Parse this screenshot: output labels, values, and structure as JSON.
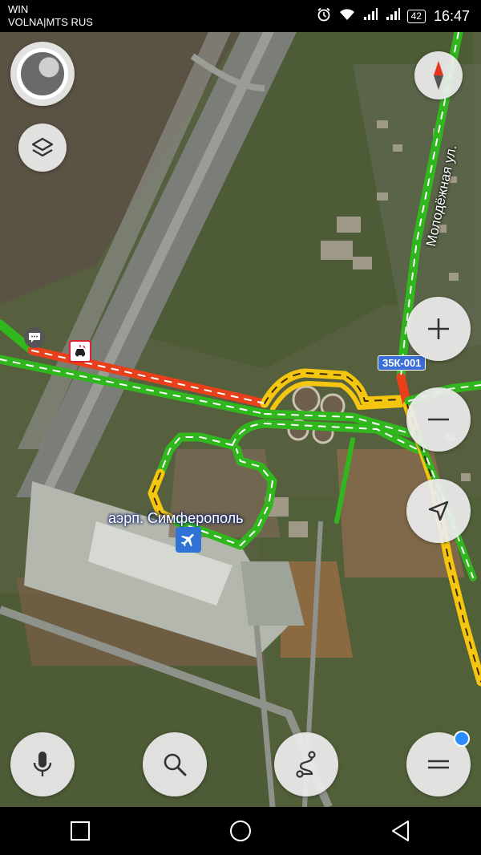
{
  "status_bar": {
    "carrier_line1": "WIN",
    "carrier_line2": "VOLNA|MTS RUS",
    "battery": "42",
    "time": "16:47",
    "icons": [
      "alarm-icon",
      "wifi-icon",
      "signal-icon",
      "signal-icon",
      "battery-icon"
    ]
  },
  "map": {
    "road_label": "Молодёжная ул.",
    "route_badge": "35К-001",
    "poi_label": "аэрп. Симферополь",
    "poi_icon": "airplane-icon",
    "incident_icon": "road-accident-icon",
    "chat_icon": "chat-bubble-icon"
  },
  "controls": {
    "profile": "profile-avatar",
    "layers": "layers-icon",
    "compass": "compass-icon",
    "zoom_in": "plus-icon",
    "zoom_out": "minus-icon",
    "my_location": "location-arrow-icon",
    "voice": "microphone-icon",
    "search": "search-icon",
    "routes": "route-icon",
    "menu": "menu-icon"
  },
  "traffic_colors": {
    "free": "#31b71e",
    "slow": "#f5c60f",
    "jam": "#e8401a"
  },
  "nav_bar": [
    "back-icon",
    "home-icon",
    "recents-icon"
  ]
}
